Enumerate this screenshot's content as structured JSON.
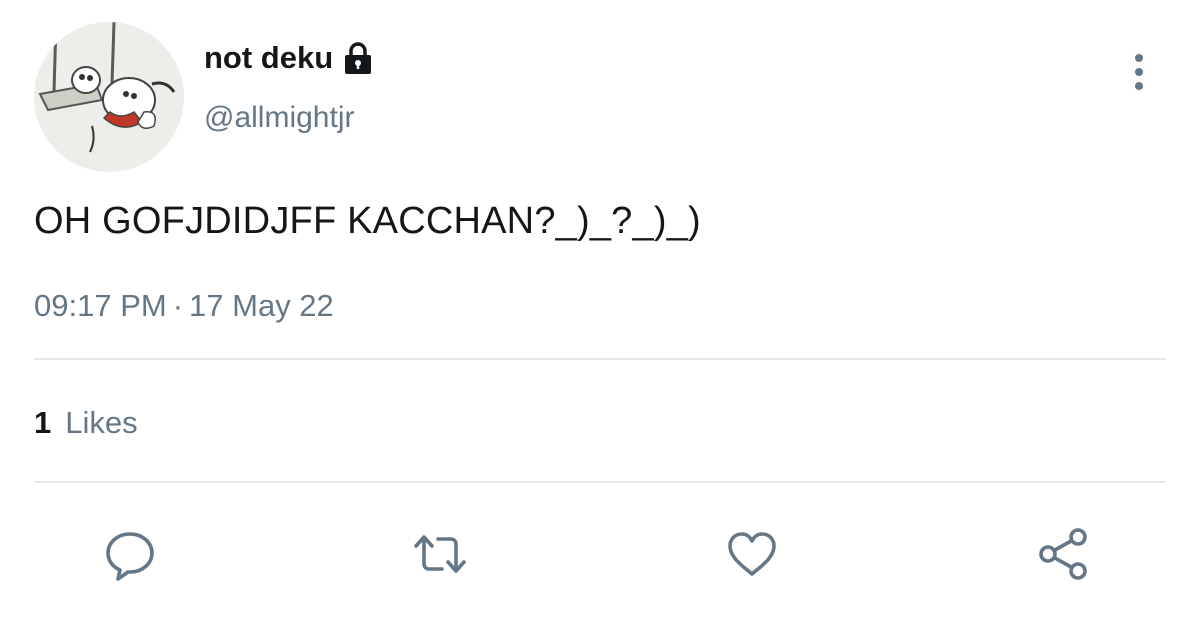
{
  "tweet": {
    "author": {
      "display_name": "not deku",
      "handle": "@allmightjr",
      "protected": true
    },
    "text": "OH GOFJDIDJFF KACCHAN?_)_?_)_)",
    "time": "09:17 PM",
    "separator": "·",
    "date": "17 May 22",
    "likes": {
      "count": "1",
      "label": "Likes"
    }
  },
  "actions": [
    {
      "name": "reply",
      "icon": "reply-icon"
    },
    {
      "name": "retweet",
      "icon": "retweet-icon"
    },
    {
      "name": "like",
      "icon": "heart-icon"
    },
    {
      "name": "share",
      "icon": "share-icon"
    }
  ],
  "colors": {
    "primary_text": "#14171a",
    "secondary_text": "#657786",
    "divider": "#e1e8ed",
    "icon": "#657786"
  }
}
